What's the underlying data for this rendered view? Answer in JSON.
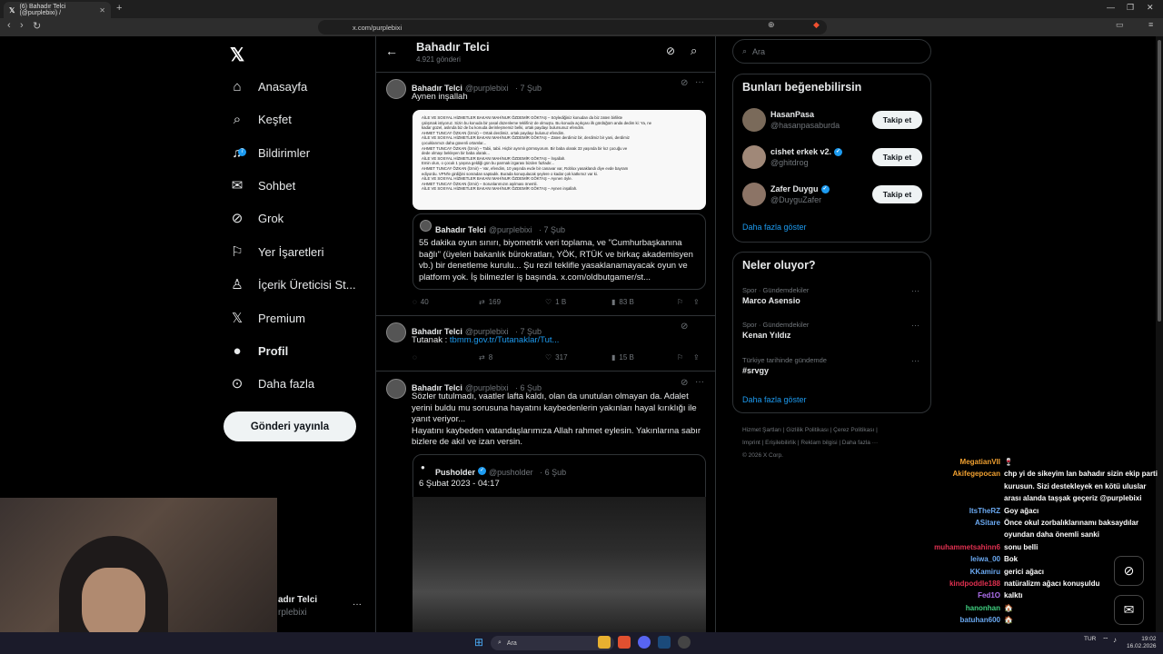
{
  "browser": {
    "tab_title": "(6) Bahadır Telci (@purplebixi) /",
    "url": "x.com/purplebixi"
  },
  "nav": {
    "items": [
      {
        "label": "Anasayfa",
        "icon": "home-icon"
      },
      {
        "label": "Keşfet",
        "icon": "search-icon"
      },
      {
        "label": "Bildirimler",
        "icon": "bell-icon",
        "badge": "7"
      },
      {
        "label": "Sohbet",
        "icon": "mail-icon"
      },
      {
        "label": "Grok",
        "icon": "grok-icon"
      },
      {
        "label": "Yer İşaretleri",
        "icon": "bookmark-icon"
      },
      {
        "label": "İçerik Üreticisi St...",
        "icon": "creator-icon"
      },
      {
        "label": "Premium",
        "icon": "x-logo-icon"
      },
      {
        "label": "Profil",
        "icon": "person-icon"
      },
      {
        "label": "Daha fazla",
        "icon": "more-circle-icon"
      }
    ],
    "post_button": "Gönderi yayınla",
    "account_name": "adır Telci",
    "account_handle": "rplebixi"
  },
  "profile_header": {
    "name": "Bahadır Telci",
    "posts": "4.921 gönderi"
  },
  "tweets": [
    {
      "name": "Bahadır Telci",
      "handle": "@purplebixi",
      "date": "· 7 Şub",
      "text": "Aynen inşallah",
      "doc_lines": [
        "AİLE VE SOSYAL HİZMETLER BAKANI MAHİNUR ÖZDEMİR GÖKTAŞ – Söylediğiniz konudan da biz zaten birlikte",
        "çalışmak istiyoruz. Sizin bu konuda bir yasal düzenleme teklifiniz de olmuştu. Bu konuda açıkçası ilk gördüğüm anda dedim ki: Ya, ne",
        "kadar güzel, aslında biz de bu konuda derinleşmemiz belki, ortak paydayı bulursunuz efendim.",
        "AHMET TUNCAY ÖZKAN (İzmir) – Ortak derdimiz, ortak paydayı bulunuz efendim.",
        "AİLE VE SOSYAL HİZMETLER BAKANI MAHİNUR ÖZDEMİR GÖKTAŞ – Zaten derdimiz bir, derdimiz bir yani, derdimiz",
        "çocuklarımızı daha güvenli ortamlar...",
        "AHMET TUNCAY ÖZKAN (İzmir) – Tabii, tabii. Hiçbir ayrımlı görmüyorum. Bir baba olarak 33 yaşında bir kız çocuğu ve",
        "dede olmayı bekleyen bir baba olarak...",
        "AİLE VE SOSYAL HİZMETLER BAKANI MAHİNUR ÖZDEMİR GÖKTAŞ – İnşallah.",
        "Emin olun, o çocuk 1 yaşına geldiği gün bu parmak izgarası bizden fazladır...",
        "AHMET TUNCAY ÖZKAN (İzmir) – Var, efendim, 10 yaşında evde bir canavar var, Roblox yasaklandı diye evde bayram",
        "ediyordu. VPN'le girdiğini sonradan saptadık. Burada konuşulacak şeylere o kadar çok katkımız var ki.",
        "AİLE VE SOSYAL HİZMETLER BAKANI MAHİNUR ÖZDEMİR GÖKTAŞ – Ayınen öyle.",
        "AHMET TUNCAY ÖZKAN (İzmir) – Sorunlarımızın aşılması önemli.",
        "AİLE VE SOSYAL HİZMETLER BAKANI MAHİNUR ÖZDEMİR GÖKTAŞ – Aynen inşallah."
      ],
      "quote": {
        "name": "Bahadır Telci",
        "handle": "@purplebixi",
        "date": "· 7 Şub",
        "text": "55 dakika oyun sınırı, biyometrik veri toplama, ve \"Cumhurbaşkanına bağlı\" (üyeleri bakanlık bürokratları, YÖK, RTÜK ve birkaç akademisyen vb.) bir denetleme kurulu... Şu rezil teklifle yasaklanamayacak oyun ve platform yok. İş bilmezler iş başında. x.com/oldbutgamer/st..."
      },
      "replies": "40",
      "reposts": "169",
      "likes": "1 B",
      "views": "83 B"
    },
    {
      "name": "Bahadır Telci",
      "handle": "@purplebixi",
      "date": "· 7 Şub",
      "text_prefix": "Tutanak : ",
      "link": "tbmm.gov.tr/Tutanaklar/Tut...",
      "replies": "",
      "reposts": "8",
      "likes": "317",
      "views": "15 B"
    },
    {
      "name": "Bahadır Telci",
      "handle": "@purplebixi",
      "date": "· 6 Şub",
      "text": "Sözler tutulmadı, vaatler lafta kaldı, olan da unutulan olmayan da. Adalet yerini buldu mu sorusuna hayatını kaybedenlerin yakınları hayal kırıklığı ile yanıt veriyor...\nHayatını kaybeden vatandaşlarımıza Allah rahmet eylesin. Yakınlarına sabır bizlere de akıl ve izan versin.",
      "quote": {
        "name": "Pusholder",
        "handle": "@pusholder",
        "date": "· 6 Şub",
        "text": "6 Şubat 2023 - 04:17"
      }
    }
  ],
  "right": {
    "search_placeholder": "Ara",
    "suggest_title": "Bunları beğenebilirsin",
    "suggestions": [
      {
        "name": "HasanPasa",
        "handle": "@hasanpasaburda",
        "verified": false,
        "button": "Takip et"
      },
      {
        "name": "cishet erkek v2.",
        "handle": "@ghitdrog",
        "verified": true,
        "button": "Takip et"
      },
      {
        "name": "Zafer Duygu",
        "handle": "@DuyguZafer",
        "verified": true,
        "button": "Takip et"
      }
    ],
    "show_more": "Daha fazla göster",
    "trends_title": "Neler oluyor?",
    "trends": [
      {
        "category": "Spor · Gündemdekiler",
        "name": "Marco Asensio"
      },
      {
        "category": "Spor · Gündemdekiler",
        "name": "Kenan Yıldız"
      },
      {
        "category": "Türkiye tarihinde gündemde",
        "name": "#srvgy"
      }
    ],
    "trends_more": "Daha fazla göster",
    "footer_line1": "Hizmet Şartları  |  Gizlilik Politikası  |  Çerez Politikası  |",
    "footer_line2": "Imprint  |  Erişilebilirlik  |  Reklam bilgisi  |  Daha fazla ···",
    "footer_line3": "© 2026 X Corp."
  },
  "chat": [
    {
      "user": "MegatianVII",
      "color": "#f0a030",
      "msg": "🍷"
    },
    {
      "user": "Akifegepocan",
      "color": "#f0a030",
      "msg": "chp yi de sikeyim lan bahadır sizin ekip parti kurusun. Sizi destekleyek en kötü uluslar arası alanda taşşak geçeriz @purplebixi"
    },
    {
      "user": "ItsTheRZ",
      "color": "#6aa8f0",
      "msg": "Goy ağacı"
    },
    {
      "user": "ASitare",
      "color": "#6aa8f0",
      "msg": "Önce okul zorbalıklarınamı baksaydılar oyundan daha önemli sanki"
    },
    {
      "user": "muhammetsahinn6",
      "color": "#e03050",
      "msg": "sonu belli"
    },
    {
      "user": "leiwa_00",
      "color": "#6aa8f0",
      "msg": "Bok"
    },
    {
      "user": "KKamiru",
      "color": "#6aa8f0",
      "msg": "gerici ağacı"
    },
    {
      "user": "kindpoddle188",
      "color": "#e03050",
      "msg": "natüralizm ağacı konuşuldu"
    },
    {
      "user": "Fed1O",
      "color": "#b070f0",
      "msg": "kalktı"
    },
    {
      "user": "hanonhan",
      "color": "#40d080",
      "msg": "🏠"
    },
    {
      "user": "batuhan600",
      "color": "#6aa8f0",
      "msg": "🏠"
    }
  ],
  "taskbar": {
    "search": "Ara",
    "lang": "TUR",
    "time": "19:02",
    "date": "16.02.2026"
  }
}
